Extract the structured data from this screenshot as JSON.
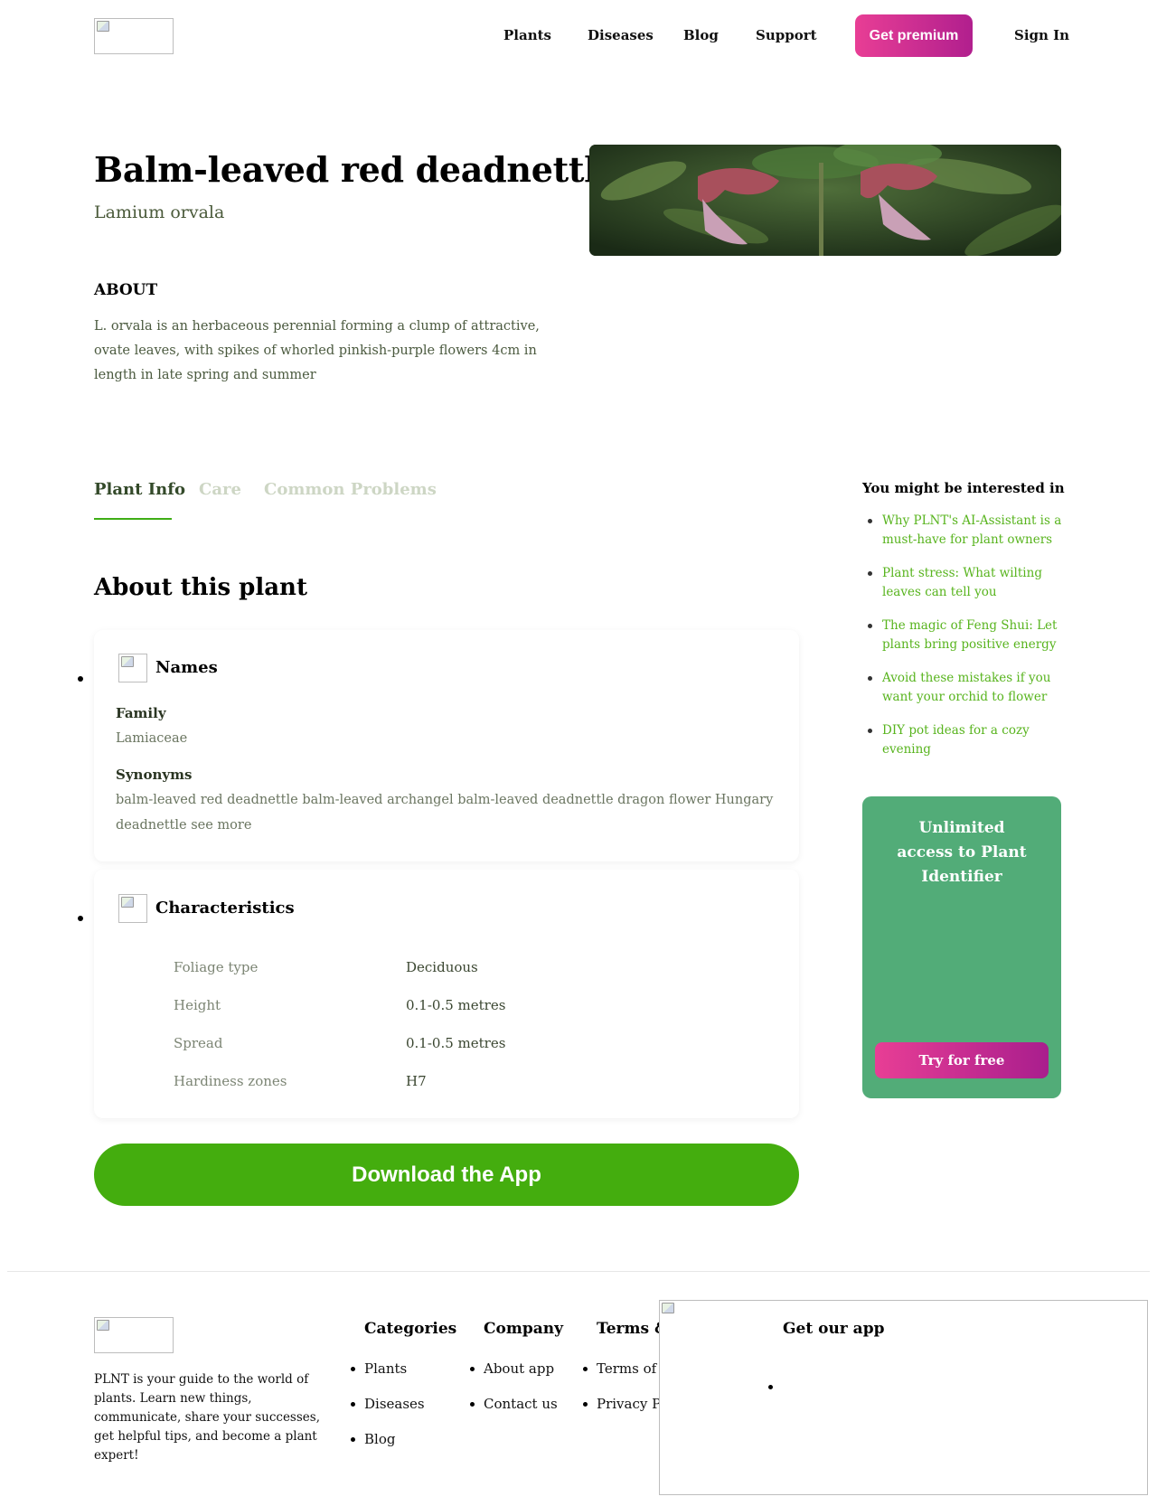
{
  "header": {
    "logo_alt": "",
    "nav": [
      "Plants",
      "Diseases",
      "Blog",
      "Support"
    ],
    "premium_label": "Get premium",
    "signin_label": "Sign In"
  },
  "plant": {
    "name": "Balm-leaved red deadnettle",
    "latin": "Lamium orvala",
    "about_heading": "ABOUT",
    "about_text": "L. orvala is an herbaceous perennial forming a clump of attractive, ovate leaves, with spikes of whorled pinkish-purple flowers 4cm in length in late spring and summer"
  },
  "tabs": [
    {
      "label": "Plant Info",
      "active": true
    },
    {
      "label": "Care",
      "active": false
    },
    {
      "label": "Common Problems",
      "active": false
    }
  ],
  "section_title": "About this plant",
  "names_card": {
    "title": "Names",
    "icon": "names-icon",
    "family_label": "Family",
    "family_value": "Lamiaceae",
    "synonyms_label": "Synonyms",
    "synonyms_value": "balm-leaved red deadnettle balm-leaved archangel balm-leaved deadnettle dragon flower Hungary deadnettle see more"
  },
  "characteristics_card": {
    "title": "Characteristics",
    "icon": "characteristics-icon",
    "rows": [
      {
        "label": "Foliage type",
        "value": "Deciduous"
      },
      {
        "label": "Height",
        "value": "0.1-0.5 metres"
      },
      {
        "label": "Spread",
        "value": "0.1-0.5 metres"
      },
      {
        "label": "Hardiness zones",
        "value": "H7"
      }
    ]
  },
  "download_label": "Download the App",
  "sidebar": {
    "heading": "You might be interested in",
    "links": [
      "Why PLNT's AI-Assistant is a must-have for plant owners",
      "Plant stress: What wilting leaves can tell you",
      "The magic of Feng Shui: Let plants bring positive energy",
      "Avoid these mistakes if you want your orchid to flower",
      "DIY pot ideas for a cozy evening"
    ],
    "promo_title": "Unlimited access to Plant Identifier",
    "promo_button": "Try for free"
  },
  "footer": {
    "description": "PLNT is your guide to the world of plants. Learn new things, communicate, share your successes, get helpful tips, and become a plant expert!",
    "categories_heading": "Categories",
    "categories": [
      "Plants",
      "Diseases",
      "Blog"
    ],
    "company_heading": "Company",
    "company": [
      "About app",
      "Contact us"
    ],
    "terms_heading": "Terms & Conditions",
    "terms": [
      "Terms of Services",
      "Privacy Policy"
    ],
    "app_heading": "Get our app"
  },
  "colors": {
    "accent_green": "#44ad0e",
    "link_green": "#58b41e",
    "promo_green": "#52ac78",
    "premium_gradient_start": "#e83e95",
    "premium_gradient_end": "#b11f8e"
  }
}
